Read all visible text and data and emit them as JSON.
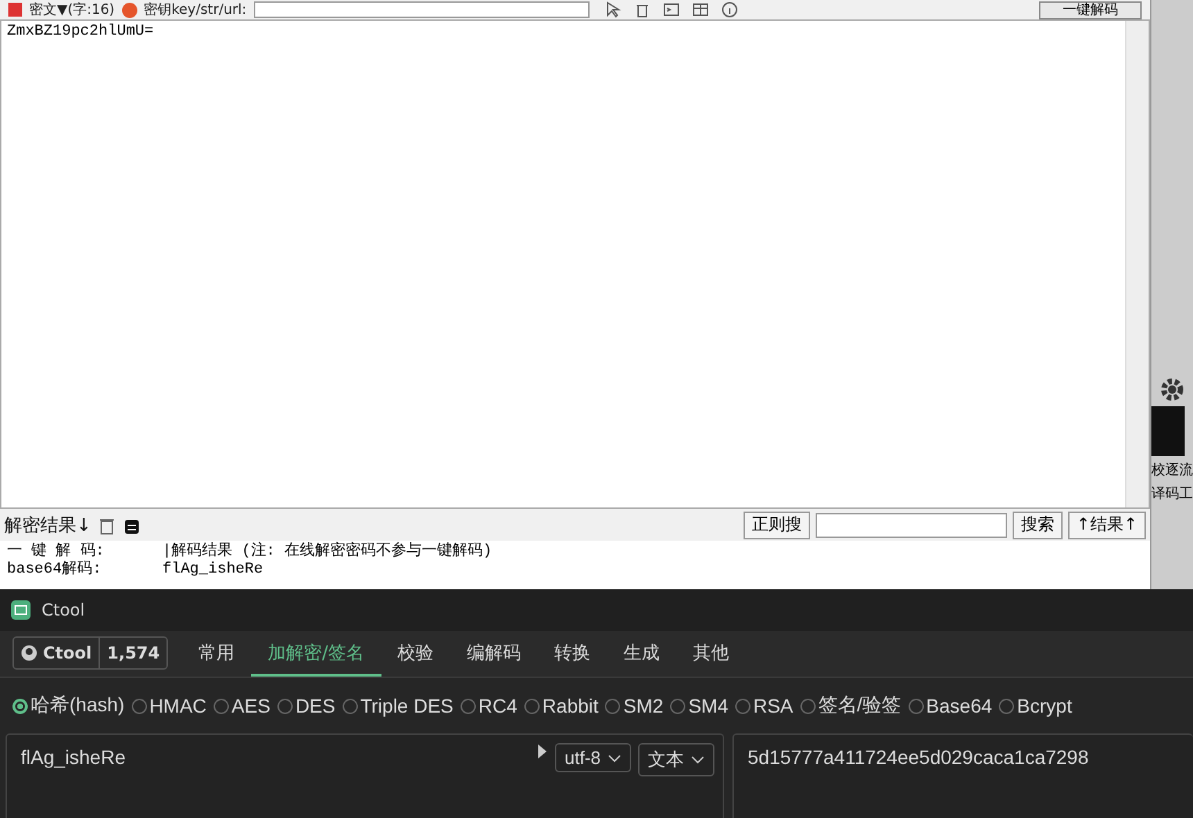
{
  "toolbar": {
    "ciphertext_label": "密文▼(字:16)",
    "key_label": "密钥key/str/url:",
    "decode_button": "一键解码"
  },
  "ciphertext": "ZmxBZ19pc2hlUmU=",
  "result_bar": {
    "title": "解密结果↓",
    "regex_button": "正则搜",
    "search_button": "搜索",
    "result_up_button": "↑结果↑"
  },
  "result_lines": [
    {
      "label": "一 键 解 码:",
      "value": "|解码结果 (注: 在线解密密码不参与一键解码)"
    },
    {
      "label": "base64解码:",
      "value": "flAg_isheRe"
    }
  ],
  "side_texts": [
    "校逐流",
    "译码工"
  ],
  "app": {
    "title": "Ctool",
    "github": {
      "label": "Ctool",
      "count": "1,574"
    },
    "tabs": [
      {
        "label": "常用",
        "selected": false
      },
      {
        "label": "加解密/签名",
        "selected": true
      },
      {
        "label": "校验",
        "selected": false
      },
      {
        "label": "编解码",
        "selected": false
      },
      {
        "label": "转换",
        "selected": false
      },
      {
        "label": "生成",
        "selected": false
      },
      {
        "label": "其他",
        "selected": false
      }
    ],
    "algorithms": [
      {
        "label": "哈希(hash)",
        "selected": true
      },
      {
        "label": "HMAC",
        "selected": false
      },
      {
        "label": "AES",
        "selected": false
      },
      {
        "label": "DES",
        "selected": false
      },
      {
        "label": "Triple DES",
        "selected": false
      },
      {
        "label": "RC4",
        "selected": false
      },
      {
        "label": "Rabbit",
        "selected": false
      },
      {
        "label": "SM2",
        "selected": false
      },
      {
        "label": "SM4",
        "selected": false
      },
      {
        "label": "RSA",
        "selected": false
      },
      {
        "label": "签名/验签",
        "selected": false
      },
      {
        "label": "Base64",
        "selected": false
      },
      {
        "label": "Bcrypt",
        "selected": false
      }
    ],
    "input": {
      "value": "flAg_isheRe",
      "encoding": "utf-8",
      "format": "文本"
    },
    "output": {
      "value": "5d15777a411724ee5d029caca1ca7298"
    }
  }
}
